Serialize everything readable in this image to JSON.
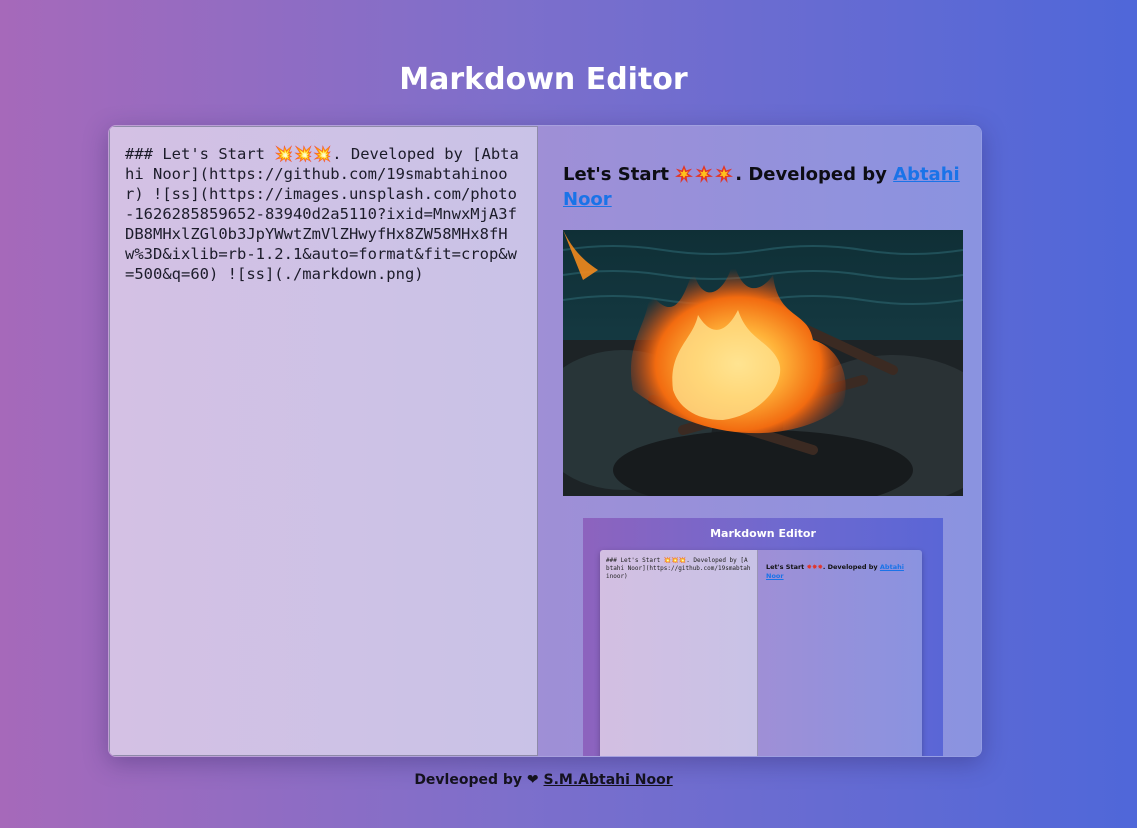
{
  "header": {
    "title": "Markdown Editor"
  },
  "editor": {
    "markdown_text": "### Let's Start 💥💥💥. Developed by [Abtahi Noor](https://github.com/19smabtahinoor) ![ss](https://images.unsplash.com/photo-1626285859652-83940d2a5110?ixid=MnwxMjA3fDB8MHxlZGl0b3JpYWwtZmVlZHwyfHx8ZW58MHx8fHw%3D&ixlib=rb-1.2.1&auto=format&fit=crop&w=500&q=60) ![ss](./markdown.png)"
  },
  "preview": {
    "heading_prefix": "Let's Start",
    "heading_suffix": ". Developed by",
    "link_text": "Abtahi Noor",
    "thumbnail": {
      "title": "Markdown Editor",
      "markdown_text": "### Let's Start 💥💥💥. Developed by [Abtahi Noor](https://github.com/19smabtahinoor)",
      "heading_prefix": "Let's Start",
      "heading_suffix": ". Developed by",
      "link_text": "Abtahi Noor"
    }
  },
  "footer": {
    "prefix": "Devleoped by",
    "heart": "❤",
    "author": "S.M.Abtahi Noor"
  },
  "colors": {
    "background_start": "#a669ba",
    "background_end": "#4f67d9",
    "link": "#1a73e8"
  }
}
